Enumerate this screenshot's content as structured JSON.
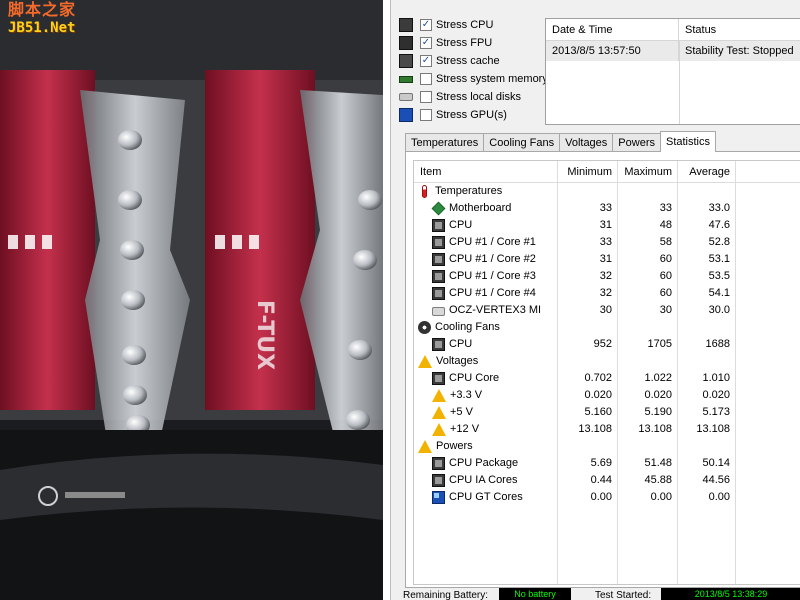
{
  "watermark": {
    "line1": "脚本之家",
    "line2": "JB51.Net"
  },
  "photo": {
    "label": "F-TUX"
  },
  "stress_options": [
    {
      "label": "Stress CPU",
      "checked": true,
      "icon": "cpu-icon"
    },
    {
      "label": "Stress FPU",
      "checked": true,
      "icon": "fpu-icon"
    },
    {
      "label": "Stress cache",
      "checked": true,
      "icon": "cache-icon"
    },
    {
      "label": "Stress system memory",
      "checked": false,
      "icon": "memory-icon"
    },
    {
      "label": "Stress local disks",
      "checked": false,
      "icon": "disk-icon"
    },
    {
      "label": "Stress GPU(s)",
      "checked": false,
      "icon": "gpu-icon"
    }
  ],
  "status_grid": {
    "headers": {
      "datetime": "Date & Time",
      "status": "Status"
    },
    "rows": [
      {
        "datetime": "2013/8/5 13:57:50",
        "status": "Stability Test: Stopped"
      }
    ]
  },
  "tabs": [
    "Temperatures",
    "Cooling Fans",
    "Voltages",
    "Powers",
    "Statistics"
  ],
  "active_tab": "Statistics",
  "stats": {
    "headers": {
      "item": "Item",
      "min": "Minimum",
      "max": "Maximum",
      "avg": "Average"
    },
    "rows": [
      {
        "type": "group",
        "icon": "thermometer-icon",
        "item": "Temperatures"
      },
      {
        "type": "item",
        "icon": "motherboard-icon",
        "item": "Motherboard",
        "min": "33",
        "max": "33",
        "avg": "33.0"
      },
      {
        "type": "item",
        "icon": "chip-icon",
        "item": "CPU",
        "min": "31",
        "max": "48",
        "avg": "47.6"
      },
      {
        "type": "item",
        "icon": "chip-icon",
        "item": "CPU #1 / Core #1",
        "min": "33",
        "max": "58",
        "avg": "52.8"
      },
      {
        "type": "item",
        "icon": "chip-icon",
        "item": "CPU #1 / Core #2",
        "min": "31",
        "max": "60",
        "avg": "53.1"
      },
      {
        "type": "item",
        "icon": "chip-icon",
        "item": "CPU #1 / Core #3",
        "min": "32",
        "max": "60",
        "avg": "53.5"
      },
      {
        "type": "item",
        "icon": "chip-icon",
        "item": "CPU #1 / Core #4",
        "min": "32",
        "max": "60",
        "avg": "54.1"
      },
      {
        "type": "item",
        "icon": "ssd-icon",
        "item": "OCZ-VERTEX3 MI",
        "min": "30",
        "max": "30",
        "avg": "30.0"
      },
      {
        "type": "group",
        "icon": "fan-icon",
        "item": "Cooling Fans"
      },
      {
        "type": "item",
        "icon": "chip-icon",
        "item": "CPU",
        "min": "952",
        "max": "1705",
        "avg": "1688"
      },
      {
        "type": "group",
        "icon": "warning-icon",
        "item": "Voltages"
      },
      {
        "type": "item",
        "icon": "chip-icon",
        "item": "CPU Core",
        "min": "0.702",
        "max": "1.022",
        "avg": "1.010"
      },
      {
        "type": "item",
        "icon": "warning-icon",
        "item": "+3.3 V",
        "min": "0.020",
        "max": "0.020",
        "avg": "0.020"
      },
      {
        "type": "item",
        "icon": "warning-icon",
        "item": "+5 V",
        "min": "5.160",
        "max": "5.190",
        "avg": "5.173"
      },
      {
        "type": "item",
        "icon": "warning-icon",
        "item": "+12 V",
        "min": "13.108",
        "max": "13.108",
        "avg": "13.108"
      },
      {
        "type": "group",
        "icon": "warning-icon",
        "item": "Powers"
      },
      {
        "type": "item",
        "icon": "chip-icon",
        "item": "CPU Package",
        "min": "5.69",
        "max": "51.48",
        "avg": "50.14"
      },
      {
        "type": "item",
        "icon": "chip-icon",
        "item": "CPU IA Cores",
        "min": "0.44",
        "max": "45.88",
        "avg": "44.56"
      },
      {
        "type": "item",
        "icon": "gpu-icon",
        "item": "CPU GT Cores",
        "min": "0.00",
        "max": "0.00",
        "avg": "0.00"
      }
    ]
  },
  "bottom": {
    "battery_label": "Remaining Battery:",
    "battery_value": "No battery",
    "test_started_label": "Test Started:",
    "test_started_value": "2013/8/5 13:38:29"
  },
  "colors": {
    "lcd_bg": "#000000",
    "lcd_text": "#00ff00",
    "heatsink_red": "#b0203a",
    "watermark_orange": "#f36a2a",
    "watermark_yellow": "#ffd21a"
  }
}
